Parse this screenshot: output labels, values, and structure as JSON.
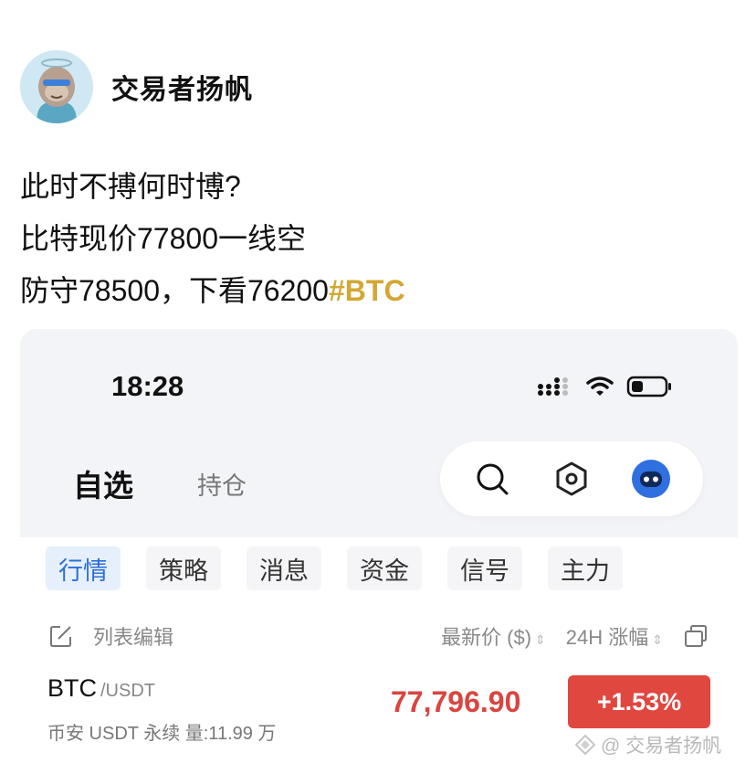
{
  "post": {
    "author": "交易者扬帆",
    "lines": [
      "此时不搏何时博?",
      "比特现价77800一线空",
      "防守78500，下看76200"
    ],
    "hashtag": "#BTC"
  },
  "card": {
    "status": {
      "time": "18:28",
      "icons": [
        "signal-icon",
        "wifi-icon",
        "battery-icon"
      ]
    },
    "top_tabs": {
      "active": "自选",
      "other": "持仓"
    },
    "toolbar": {
      "icons": [
        "search-icon",
        "settings-hex-icon",
        "bot-avatar-icon"
      ]
    },
    "filters": [
      "行情",
      "策略",
      "消息",
      "资金",
      "信号",
      "主力"
    ],
    "active_filter": 0,
    "list_header": {
      "edit_label": "列表编辑",
      "price_col": "最新价 ($)",
      "change_col": "24H 涨幅"
    },
    "row": {
      "symbol": "BTC",
      "quote": "/USDT",
      "subline": "币安 USDT 永续  量:11.99 万",
      "price": "77,796.90",
      "change": "+1.53%"
    }
  },
  "watermark": "@ 交易者扬帆",
  "colors": {
    "accent": "#d2a733",
    "down_red": "#d9453f",
    "change_bg": "#e0473f",
    "active_chip": "#2b6fd6"
  }
}
